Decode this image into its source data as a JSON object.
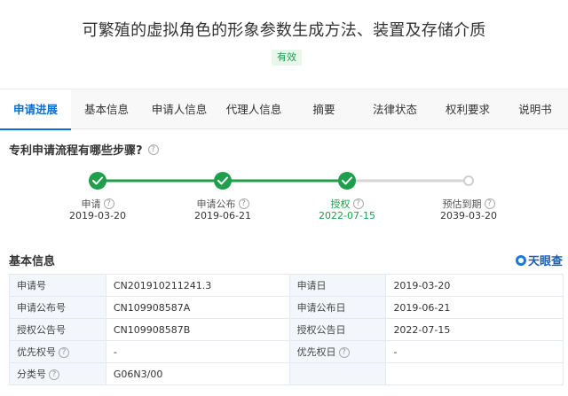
{
  "header": {
    "title": "可繁殖的虚拟角色的形象参数生成方法、装置及存储介质",
    "status": "有效"
  },
  "tabs": [
    {
      "label": "申请进展"
    },
    {
      "label": "基本信息"
    },
    {
      "label": "申请人信息"
    },
    {
      "label": "代理人信息"
    },
    {
      "label": "摘要"
    },
    {
      "label": "法律状态"
    },
    {
      "label": "权利要求"
    },
    {
      "label": "说明书"
    }
  ],
  "progress": {
    "question": "专利申请流程有哪些步骤?",
    "steps": [
      {
        "label": "申请",
        "date": "2019-03-20"
      },
      {
        "label": "申请公布",
        "date": "2019-06-21"
      },
      {
        "label": "授权",
        "date": "2022-07-15"
      },
      {
        "label": "预估到期",
        "date": "2039-03-20"
      }
    ]
  },
  "basic": {
    "title": "基本信息",
    "brand": "天眼查",
    "rows": [
      {
        "l1": "申请号",
        "v1": "CN201910211241.3",
        "l2": "申请日",
        "v2": "2019-03-20"
      },
      {
        "l1": "申请公布号",
        "v1": "CN109908587A",
        "l2": "申请公布日",
        "v2": "2019-06-21"
      },
      {
        "l1": "授权公告号",
        "v1": "CN109908587B",
        "l2": "授权公告日",
        "v2": "2022-07-15"
      },
      {
        "l1": "优先权号",
        "v1": "-",
        "l2": "优先权日",
        "v2": "-"
      },
      {
        "l1": "分类号",
        "v1": "G06N3/00",
        "l2": "",
        "v2": ""
      }
    ]
  },
  "colors": {
    "accent": "#0b6fd3",
    "done": "#1f9e4b",
    "pending": "#cfcfcf"
  }
}
